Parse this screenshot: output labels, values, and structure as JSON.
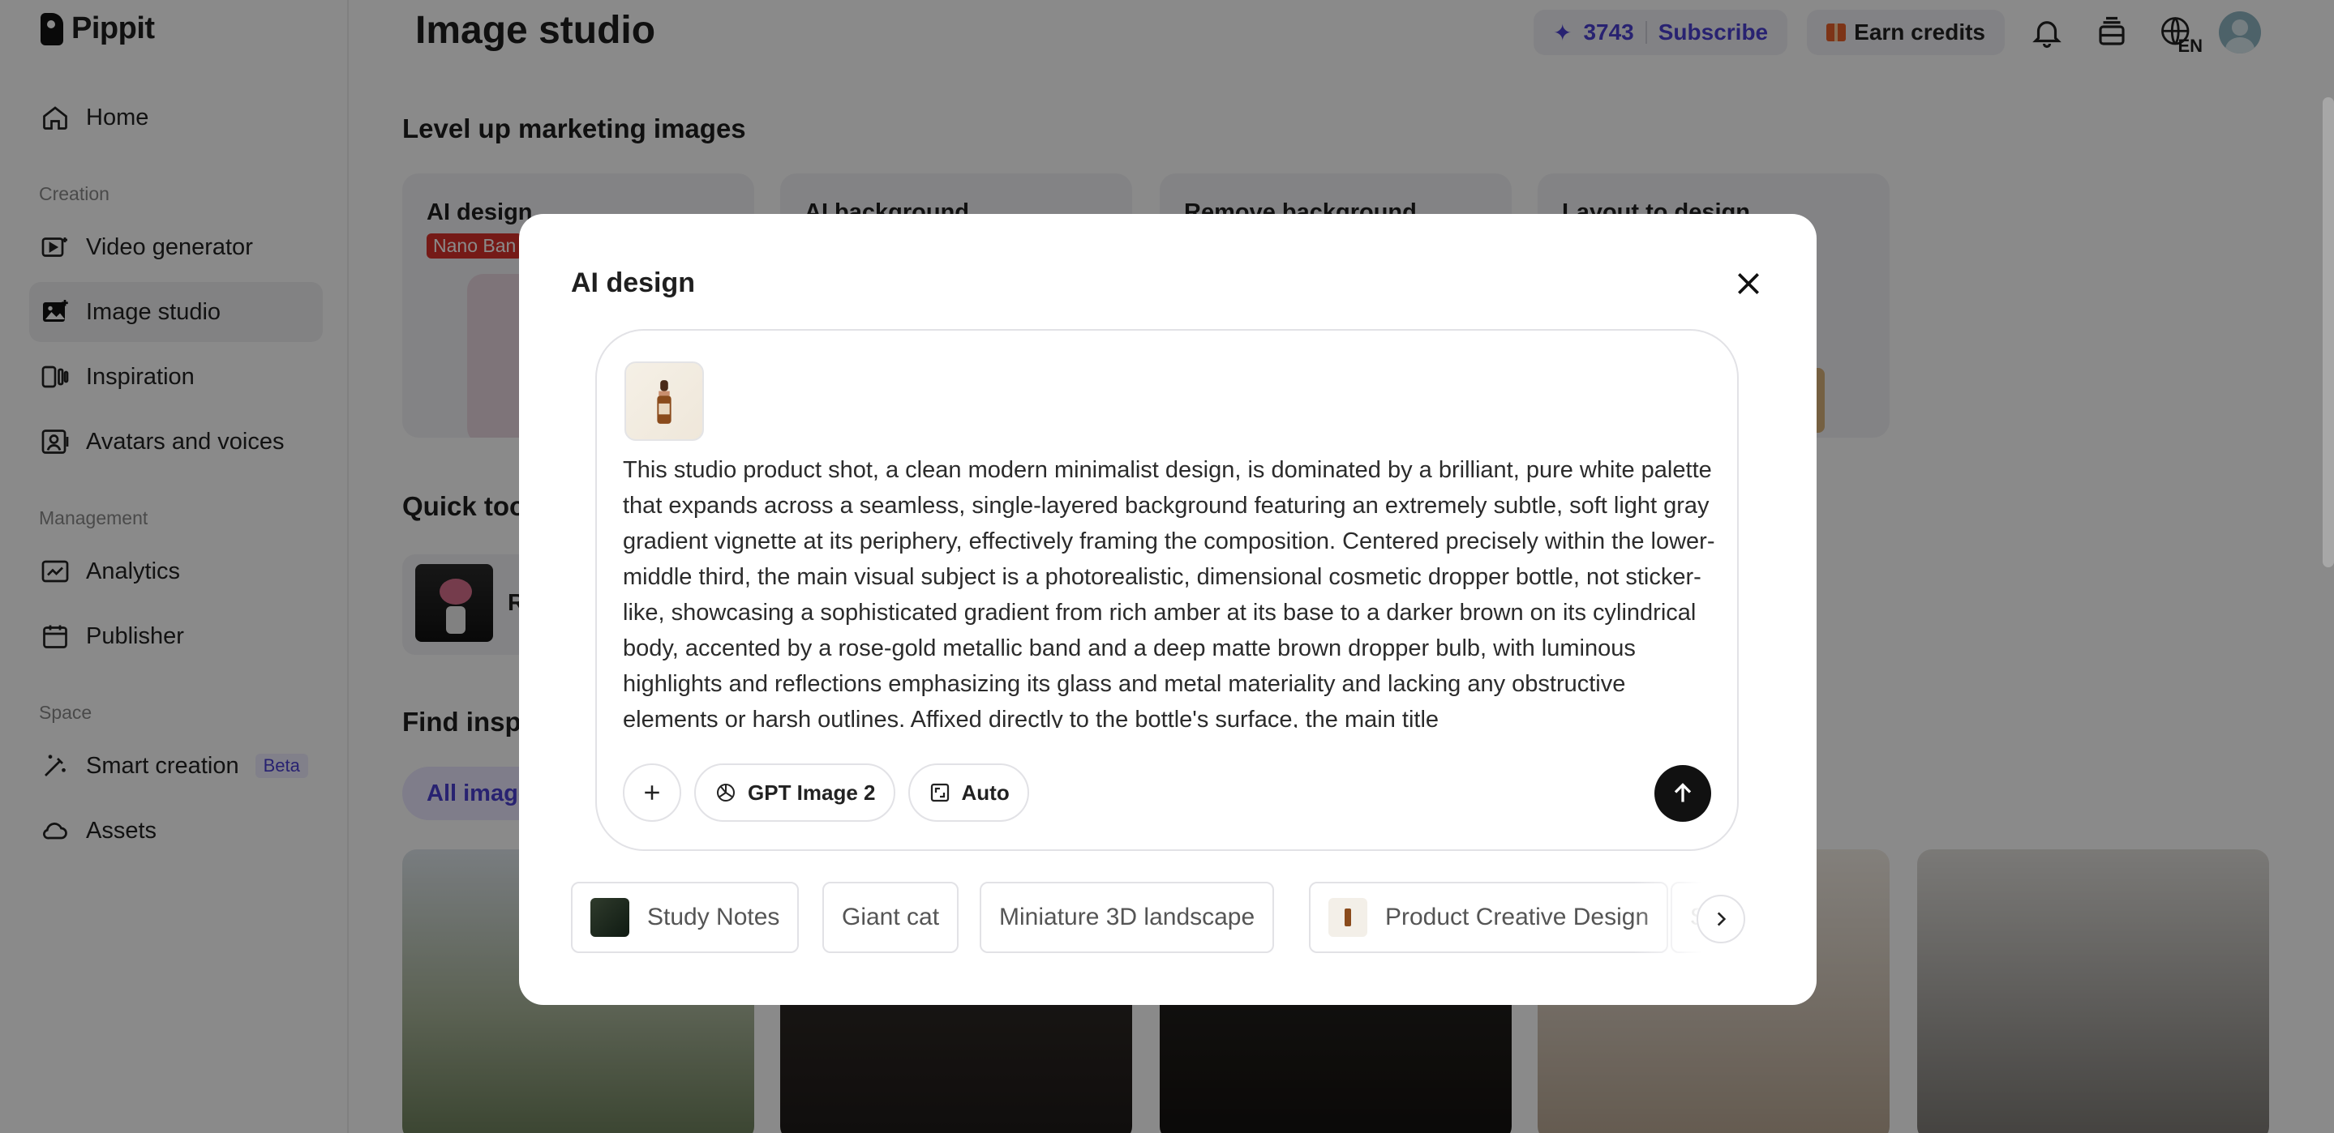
{
  "app": {
    "name": "Pippit"
  },
  "sidebar": {
    "home": "Home",
    "sections": {
      "creation": "Creation",
      "management": "Management",
      "space": "Space"
    },
    "items": {
      "video_generator": "Video generator",
      "image_studio": "Image studio",
      "inspiration": "Inspiration",
      "avatars": "Avatars and voices",
      "analytics": "Analytics",
      "publisher": "Publisher",
      "smart_creation": "Smart creation",
      "smart_creation_badge": "Beta",
      "assets": "Assets"
    }
  },
  "header": {
    "title": "Image studio",
    "credits": "3743",
    "subscribe": "Subscribe",
    "earn_credits": "Earn credits",
    "lang": "EN"
  },
  "page": {
    "section_level_up": "Level up marketing images",
    "section_quick_tools": "Quick too",
    "section_find": "Find inspi",
    "tool_cards": [
      "AI design",
      "AI background",
      "Remove background",
      "Layout to design"
    ],
    "tool_badge": "Nano Ban",
    "quick_card_label": "R",
    "filter_chip": "All image"
  },
  "modal": {
    "title": "AI design",
    "prompt": "This studio product shot, a clean modern minimalist design, is dominated by a brilliant, pure white palette that expands across a seamless, single-layered background featuring an extremely subtle, soft light gray gradient vignette at its periphery, effectively framing the composition. Centered precisely within the lower-middle third, the main visual subject is a photorealistic, dimensional cosmetic dropper bottle, not sticker-like, showcasing a sophisticated gradient from rich amber at its base to a darker brown on its cylindrical body, accented by a rose-gold metallic band and a deep matte brown dropper bulb, with luminous highlights and reflections emphasizing its glass and metal materiality and lacking any obstructive elements or harsh outlines. Affixed directly to the bottle's surface, the main title",
    "model": "GPT Image 2",
    "ratio": "Auto",
    "suggestions": [
      "Study Notes",
      "Giant cat",
      "Miniature 3D landscape",
      "Product Creative Design",
      "Sp"
    ]
  }
}
